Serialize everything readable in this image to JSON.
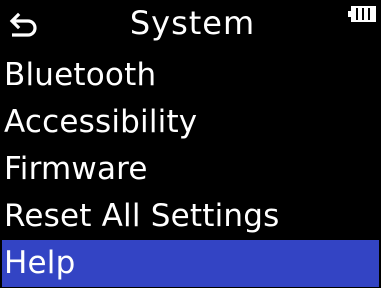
{
  "header": {
    "title": "System",
    "back_icon": "return-arrow-icon",
    "battery_icon": "battery-icon"
  },
  "menu": {
    "items": [
      {
        "label": "Bluetooth"
      },
      {
        "label": "Accessibility"
      },
      {
        "label": "Firmware"
      },
      {
        "label": "Reset All Settings"
      },
      {
        "label": "Help"
      }
    ],
    "selected_index": 4
  },
  "colors": {
    "background": "#000000",
    "text": "#ffffff",
    "selection": "#3344c4"
  }
}
